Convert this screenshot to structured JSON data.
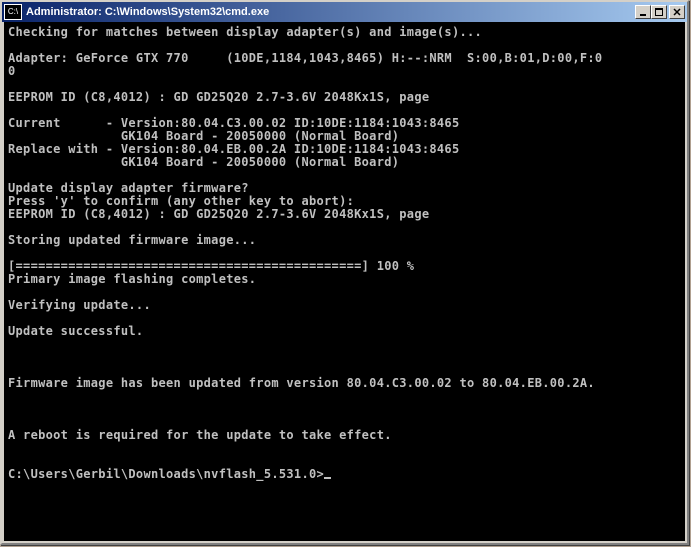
{
  "window": {
    "title": "Administrator: C:\\Windows\\System32\\cmd.exe",
    "icon_label": "C:\\"
  },
  "console": {
    "lines": [
      "Checking for matches between display adapter(s) and image(s)...",
      "",
      "Adapter: GeForce GTX 770     (10DE,1184,1043,8465) H:--:NRM  S:00,B:01,D:00,F:0",
      "0",
      "",
      "EEPROM ID (C8,4012) : GD GD25Q20 2.7-3.6V 2048Kx1S, page",
      "",
      "Current      - Version:80.04.C3.00.02 ID:10DE:1184:1043:8465",
      "               GK104 Board - 20050000 (Normal Board)",
      "Replace with - Version:80.04.EB.00.2A ID:10DE:1184:1043:8465",
      "               GK104 Board - 20050000 (Normal Board)",
      "",
      "Update display adapter firmware?",
      "Press 'y' to confirm (any other key to abort):",
      "EEPROM ID (C8,4012) : GD GD25Q20 2.7-3.6V 2048Kx1S, page",
      "",
      "Storing updated firmware image...",
      "",
      "[==============================================] 100 %",
      "Primary image flashing completes.",
      "",
      "Verifying update...",
      "",
      "Update successful.",
      "",
      "",
      "",
      "Firmware image has been updated from version 80.04.C3.00.02 to 80.04.EB.00.2A.",
      "",
      "",
      "",
      "A reboot is required for the update to take effect.",
      "",
      "",
      "C:\\Users\\Gerbil\\Downloads\\nvflash_5.531.0>"
    ]
  }
}
